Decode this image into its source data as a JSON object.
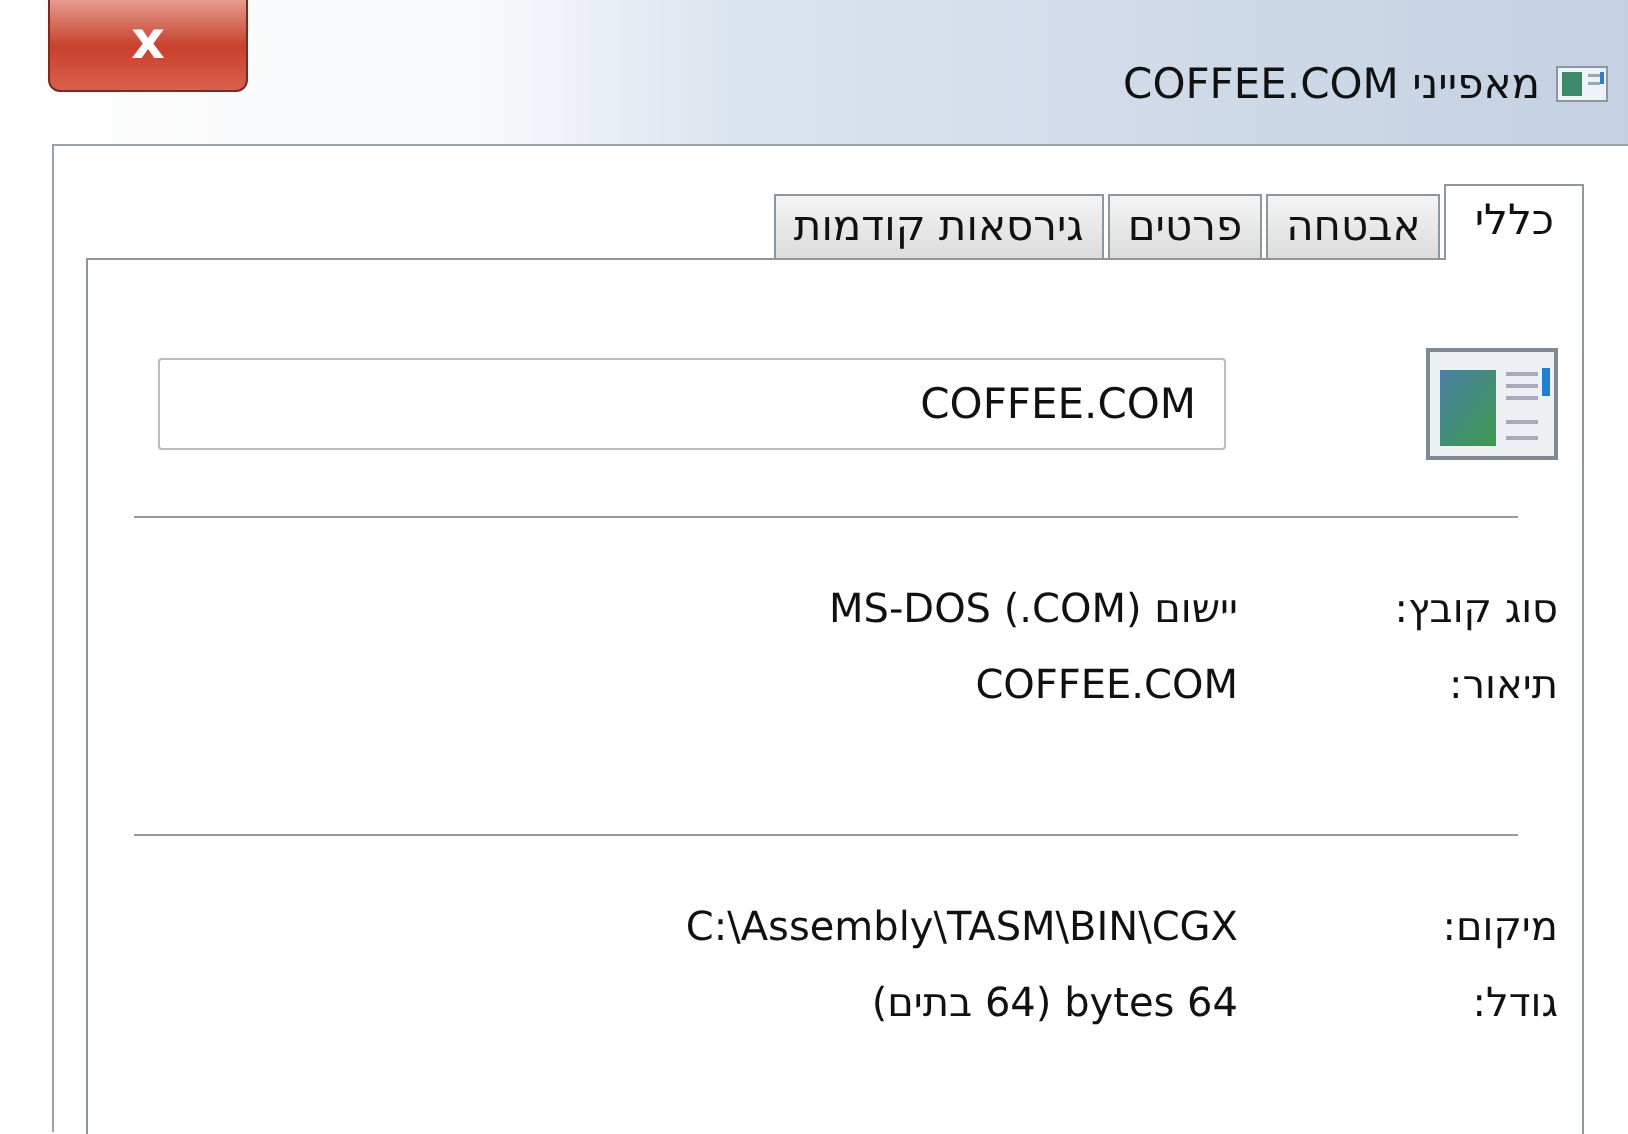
{
  "window": {
    "title": "מאפייני COFFEE.COM",
    "close": "x"
  },
  "tabs": [
    {
      "label": "כללי",
      "selected": true
    },
    {
      "label": "אבטחה",
      "selected": false
    },
    {
      "label": "פרטים",
      "selected": false
    },
    {
      "label": "גירסאות קודמות",
      "selected": false
    }
  ],
  "file_name": {
    "value": "COFFEE.COM"
  },
  "groups": [
    [
      {
        "label": "סוג קובץ:",
        "value": "יישום MS-DOS (.COM)"
      },
      {
        "label": "תיאור:",
        "value": "COFFEE.COM"
      }
    ],
    [
      {
        "label": "מיקום:",
        "value": "C:\\Assembly\\TASM\\BIN\\CGX"
      },
      {
        "label": "גודל:",
        "value": "64 bytes (64 בתים)"
      }
    ]
  ]
}
